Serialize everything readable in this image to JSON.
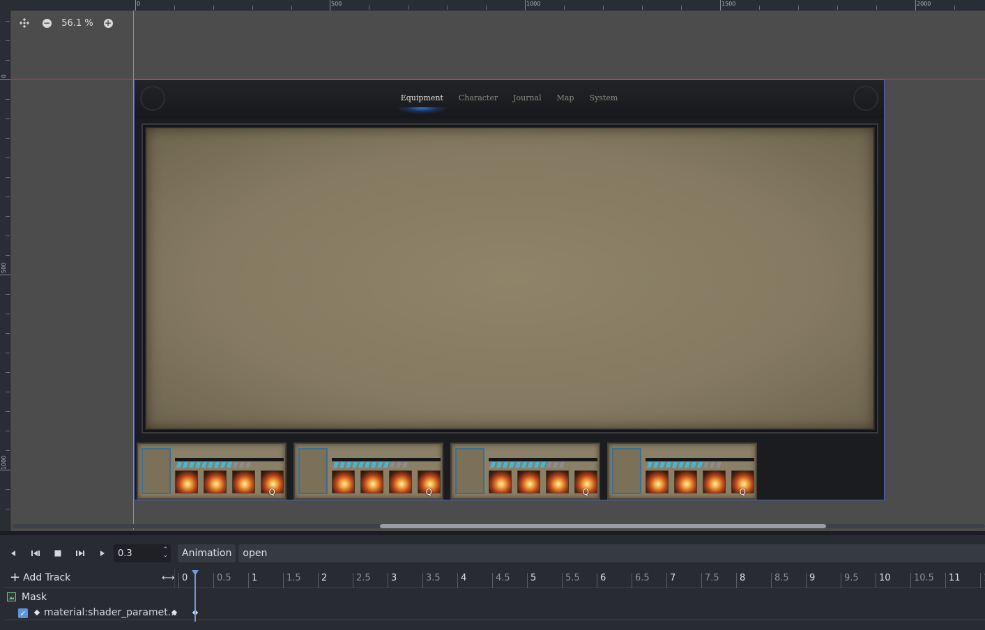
{
  "viewport": {
    "zoom": "56.1 %",
    "ruler_top_labels": [
      "0",
      "500",
      "1000",
      "1500",
      "2000"
    ],
    "ruler_left_labels": [
      "0",
      "500",
      "1000"
    ]
  },
  "game": {
    "tabs": [
      {
        "label": "Equipment",
        "active": true
      },
      {
        "label": "Character",
        "active": false
      },
      {
        "label": "Journal",
        "active": false
      },
      {
        "label": "Map",
        "active": false
      },
      {
        "label": "System",
        "active": false
      }
    ],
    "party_cards": [
      {
        "hotkey": "Q",
        "pips_on": 9,
        "pips_total": 12
      },
      {
        "hotkey": "Q",
        "pips_on": 9,
        "pips_total": 12
      },
      {
        "hotkey": "Q",
        "pips_on": 9,
        "pips_total": 12
      },
      {
        "hotkey": "Q",
        "pips_on": 9,
        "pips_total": 12
      }
    ]
  },
  "animation_panel": {
    "time_value": "0.3",
    "animation_label": "Animation",
    "animation_name": "open",
    "add_track_label": "Add Track",
    "timeline_ticks": [
      "0",
      "0.5",
      "1",
      "1.5",
      "2",
      "2.5",
      "3",
      "3.5",
      "4",
      "4.5",
      "5",
      "5.5",
      "6",
      "6.5",
      "7",
      "7.5",
      "8",
      "8.5",
      "9",
      "9.5",
      "10",
      "10.5",
      "11",
      "1"
    ],
    "tracks": [
      {
        "name": "Mask",
        "type": "node"
      },
      {
        "name": "material:shader_paramet...",
        "type": "property",
        "enabled": true
      }
    ]
  },
  "colors": {
    "accent_blue": "#5e95d9",
    "guide_red": "#c2415a",
    "guide_green": "#8aa232"
  }
}
